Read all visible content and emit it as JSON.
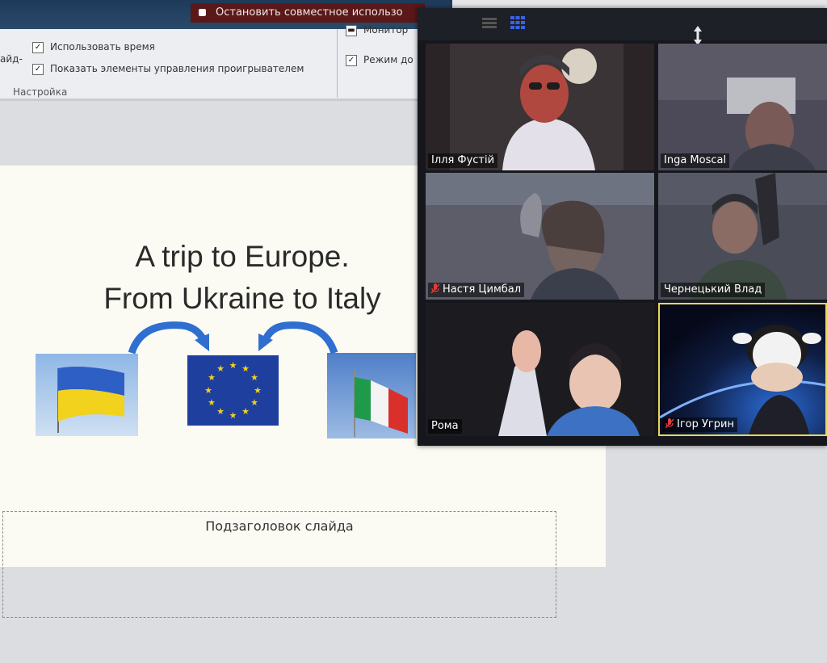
{
  "ribbon": {
    "share_bar_label": "Остановить совместное использо",
    "checkbox_use_time": "Использовать время",
    "checkbox_show_player_controls": "Показать элементы управления проигрывателем",
    "group_label": "Настройка",
    "left_edge_label": "айд-",
    "checkbox_monitor": "Монитор",
    "checkbox_mode": "Режим до"
  },
  "slide": {
    "title_line1": "A trip to Europe.",
    "title_line2": "From Ukraine to Italy",
    "subtitle_placeholder": "Подзаголовок слайда"
  },
  "zoom": {
    "participants": [
      {
        "name": "Ілля Фустій",
        "muted": false
      },
      {
        "name": "Inga Moscal",
        "muted": false
      },
      {
        "name": "Настя Цимбал",
        "muted": true
      },
      {
        "name": "Чернецький Влад",
        "muted": false
      },
      {
        "name": "Рома",
        "muted": false
      },
      {
        "name": "Ігор Угрин",
        "muted": true
      }
    ]
  },
  "colors": {
    "mic_muted": "#e03c3c",
    "active_speaker_border": "#e8d85a"
  }
}
